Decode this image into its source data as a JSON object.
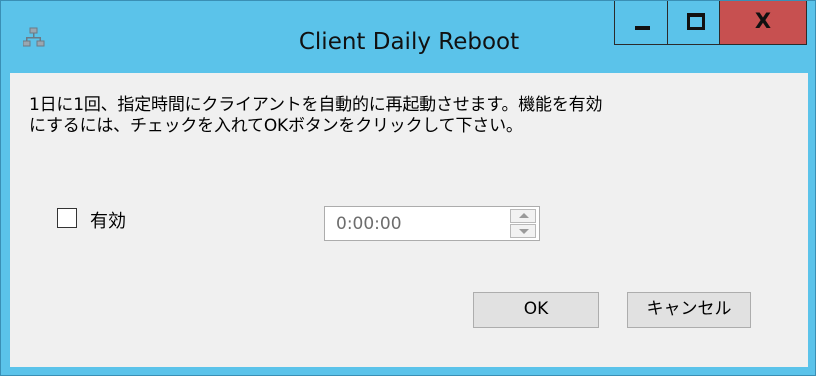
{
  "window": {
    "title": "Client Daily Reboot",
    "icon": "network-computers-icon",
    "controls": {
      "minimize": "minimize",
      "maximize": "maximize",
      "close_glyph": "X"
    },
    "colors": {
      "frame": "#5bc3ea",
      "close": "#c75050",
      "client": "#f0f0f0"
    }
  },
  "content": {
    "description_line1": "1日に1回、指定時間にクライアントを自動的に再起動させます。機能を有効",
    "description_line2": "にするには、チェックを入れてOKボタンをクリックして下さい。",
    "enable_checkbox": {
      "label": "有効",
      "checked": false
    },
    "time_picker": {
      "value": "0:00:00",
      "enabled": false
    }
  },
  "buttons": {
    "ok": "OK",
    "cancel": "キャンセル"
  }
}
